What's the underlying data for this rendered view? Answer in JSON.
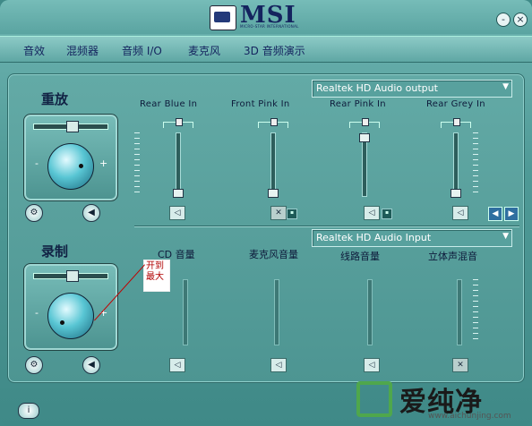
{
  "brand": {
    "logo_text": "MSI",
    "logo_subtext": "MICRO-STAR INTERNATIONAL"
  },
  "window": {
    "minimize_glyph": "-",
    "close_glyph": "×"
  },
  "menu": [
    {
      "label": "音效"
    },
    {
      "label": "混频器"
    },
    {
      "label": "音频 I/O"
    },
    {
      "label": "麦克风"
    },
    {
      "label": "3D 音频演示"
    }
  ],
  "playback": {
    "title": "重放",
    "device": "Realtek HD Audio output",
    "channels": [
      {
        "name": "Rear Blue In",
        "level": 0.0,
        "muted": false
      },
      {
        "name": "Front Pink In",
        "level": 0.0,
        "muted": true
      },
      {
        "name": "Rear Pink In",
        "level": 1.0,
        "muted": false
      },
      {
        "name": "Rear Grey In",
        "level": 0.0,
        "muted": false
      }
    ],
    "knob_minus": "-",
    "knob_plus": "+"
  },
  "record": {
    "title": "录制",
    "device": "Realtek HD Audio Input",
    "channels": [
      {
        "name": "CD 音量",
        "muted": false
      },
      {
        "name": "麦克风音量",
        "muted": false
      },
      {
        "name": "线路音量",
        "muted": false
      },
      {
        "name": "立体声混音",
        "muted": true
      }
    ],
    "annotation": [
      "开到",
      "最大"
    ],
    "knob_minus": "-",
    "knob_plus": "+"
  },
  "watermark": {
    "text": "爱纯净",
    "url": "www.aichunjing.com"
  },
  "icons": [
    "settings-icon",
    "speaker-icon",
    "speaker-muted-icon",
    "nav-left-icon",
    "nav-right-icon",
    "info-icon",
    "dropdown-arrow-icon"
  ]
}
